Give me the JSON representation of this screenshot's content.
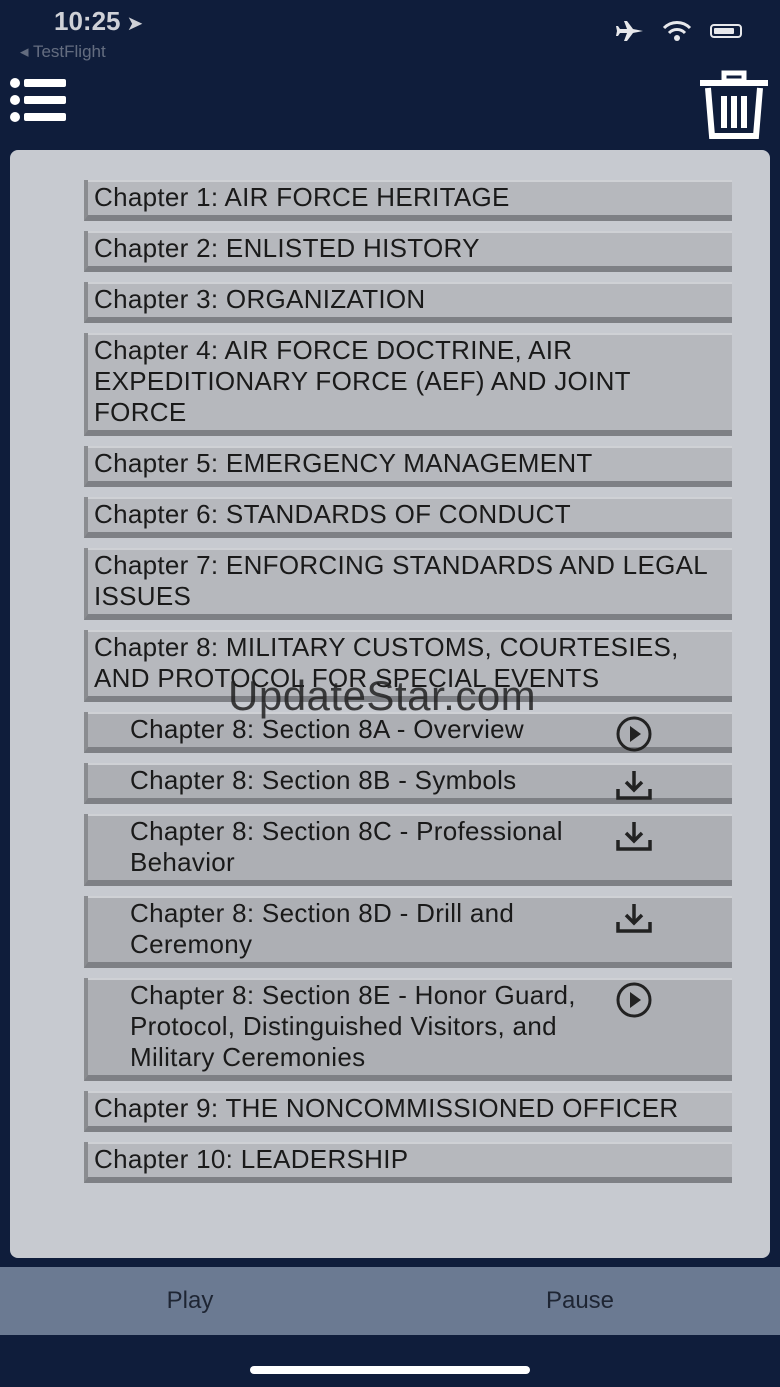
{
  "status": {
    "time": "10:25",
    "back_app": "◂ TestFlight"
  },
  "toolbar": {
    "menu_icon": "list-icon",
    "trash_icon": "trash-icon"
  },
  "chapters": [
    {
      "label": "Chapter 1: AIR FORCE HERITAGE"
    },
    {
      "label": "Chapter 2: ENLISTED HISTORY"
    },
    {
      "label": "Chapter 3: ORGANIZATION"
    },
    {
      "label": "Chapter 4: AIR FORCE DOCTRINE, AIR EXPEDITIONARY FORCE  (AEF) AND JOINT FORCE"
    },
    {
      "label": "Chapter 5: EMERGENCY MANAGEMENT"
    },
    {
      "label": "Chapter 6: STANDARDS OF CONDUCT"
    },
    {
      "label": "Chapter 7: ENFORCING STANDARDS AND LEGAL ISSUES"
    },
    {
      "label": "Chapter 8: MILITARY CUSTOMS, COURTESIES, AND PROTOCOL FOR SPECIAL EVENTS"
    }
  ],
  "sections": [
    {
      "label": "Chapter 8: Section 8A - Overview",
      "icon": "play-icon"
    },
    {
      "label": "Chapter 8: Section 8B - Symbols",
      "icon": "download-icon"
    },
    {
      "label": "Chapter 8: Section 8C - Professional Behavior",
      "icon": "download-icon"
    },
    {
      "label": "Chapter 8: Section 8D - Drill and Ceremony",
      "icon": "download-icon"
    },
    {
      "label": "Chapter 8: Section 8E - Honor Guard, Protocol, Distinguished Visitors, and Military Ceremonies",
      "icon": "play-icon"
    }
  ],
  "chapters_after": [
    {
      "label": "Chapter 9: THE NONCOMMISSIONED OFFICER"
    },
    {
      "label": "Chapter 10: LEADERSHIP"
    }
  ],
  "watermark": "UpdateStar.com",
  "bottom": {
    "play_label": "Play",
    "pause_label": "Pause"
  }
}
